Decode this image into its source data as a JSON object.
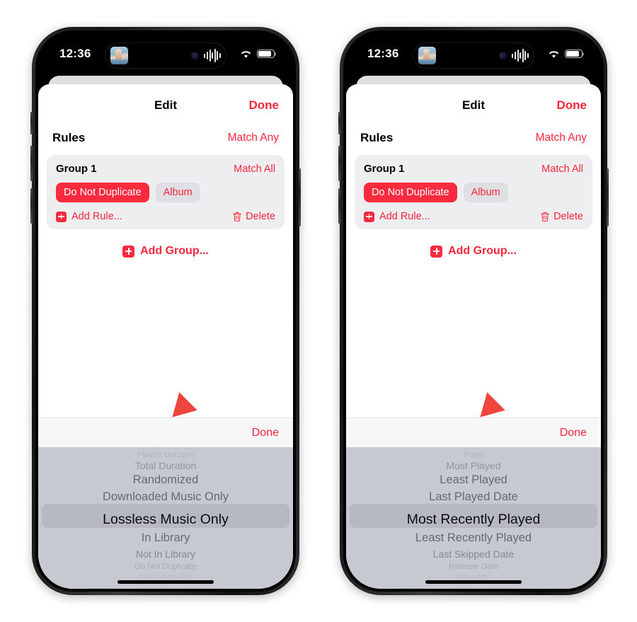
{
  "phones": [
    {
      "id": "left-phone",
      "status_bar": {
        "time": "12:36",
        "wifi_icon": "wifi-icon",
        "battery_icon": "battery-icon",
        "battery_level": 88
      },
      "dynamic_island": {
        "album_art_icon": "album-art-thumbnail",
        "face_icon": "face-id-icon",
        "waveform_icon": "audio-waveform-icon"
      },
      "sheet": {
        "nav": {
          "title": "Edit",
          "done_label": "Done"
        },
        "rules": {
          "title": "Rules",
          "match_label": "Match Any"
        },
        "group": {
          "name": "Group 1",
          "match_label": "Match All",
          "chips": [
            {
              "label": "Do Not Duplicate",
              "style": "active"
            },
            {
              "label": "Album",
              "style": "plain"
            }
          ],
          "add_rule_label": "Add Rule...",
          "delete_label": "Delete",
          "delete_icon": "trash-icon",
          "add_icon": "plus-square-icon"
        },
        "add_group_label": "Add Group...",
        "add_group_icon": "plus-square-icon"
      },
      "picker": {
        "done_label": "Done",
        "items": [
          "Playlist Duration",
          "Total Duration",
          "Randomized",
          "Downloaded Music Only",
          "Lossless Music Only",
          "In Library",
          "Not In Library",
          "Do Not Duplicate",
          "Match Genius Data"
        ],
        "selected_index": 4,
        "selected_value": "Lossless Music Only"
      },
      "home_indicator": "home-indicator"
    },
    {
      "id": "right-phone",
      "status_bar": {
        "time": "12:36",
        "wifi_icon": "wifi-icon",
        "battery_icon": "battery-icon",
        "battery_level": 88
      },
      "dynamic_island": {
        "album_art_icon": "album-art-thumbnail",
        "face_icon": "face-id-icon",
        "waveform_icon": "audio-waveform-icon"
      },
      "sheet": {
        "nav": {
          "title": "Edit",
          "done_label": "Done"
        },
        "rules": {
          "title": "Rules",
          "match_label": "Match Any"
        },
        "group": {
          "name": "Group 1",
          "match_label": "Match All",
          "chips": [
            {
              "label": "Do Not Duplicate",
              "style": "active"
            },
            {
              "label": "Album",
              "style": "plain"
            }
          ],
          "add_rule_label": "Add Rule...",
          "delete_label": "Delete",
          "delete_icon": "trash-icon",
          "add_icon": "plus-square-icon"
        },
        "add_group_label": "Add Group...",
        "add_group_icon": "plus-square-icon"
      },
      "picker": {
        "done_label": "Done",
        "items": [
          "Plays",
          "Most Played",
          "Least Played",
          "Last Played Date",
          "Most Recently Played",
          "Least Recently Played",
          "Last Skipped Date",
          "Release Date",
          "Date Added"
        ],
        "selected_index": 4,
        "selected_value": "Most Recently Played"
      },
      "home_indicator": "home-indicator"
    }
  ],
  "annotations": {
    "arrow_color": "#F0453F",
    "arrows": [
      {
        "name": "pointer-arrow-left",
        "direction": "down-left"
      },
      {
        "name": "pointer-arrow-right",
        "direction": "down-left"
      }
    ]
  },
  "colors": {
    "accent_red": "#F5273C",
    "chip_active_bg": "#FA2B3F",
    "chip_plain_bg": "#E0E0E4",
    "card_bg": "#EEEEF0",
    "picker_bg": "#C7C9D1",
    "picker_band": "#A0A3AF",
    "sheet_bg": "#FFFFFF"
  }
}
